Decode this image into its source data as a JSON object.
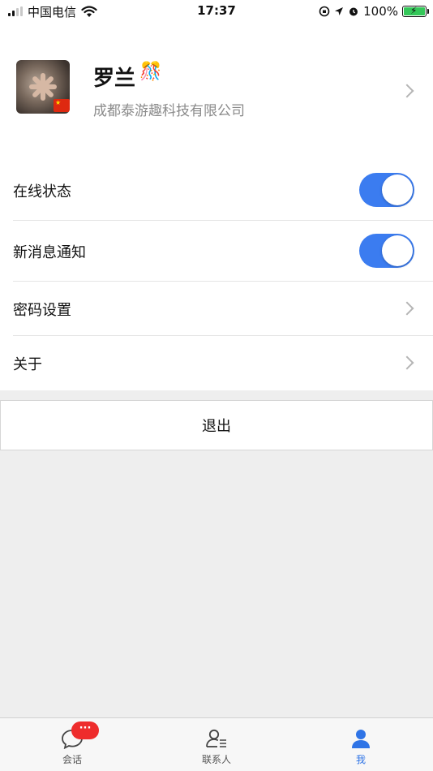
{
  "status_bar": {
    "carrier": "中国电信",
    "time": "17:37",
    "battery": "100%"
  },
  "profile": {
    "name": "罗兰",
    "company": "成都泰游趣科技有限公司"
  },
  "settings": [
    {
      "label": "在线状态",
      "toggle": true
    },
    {
      "label": "新消息通知",
      "toggle": true
    },
    {
      "label": "密码设置"
    },
    {
      "label": "关于"
    }
  ],
  "logout_label": "退出",
  "tabs": [
    {
      "label": "会话",
      "badge": "···"
    },
    {
      "label": "联系人"
    },
    {
      "label": "我",
      "active": true
    }
  ],
  "colors": {
    "accent": "#3b7cf0",
    "badge": "#ee2c2c",
    "background": "#eeeeee"
  }
}
